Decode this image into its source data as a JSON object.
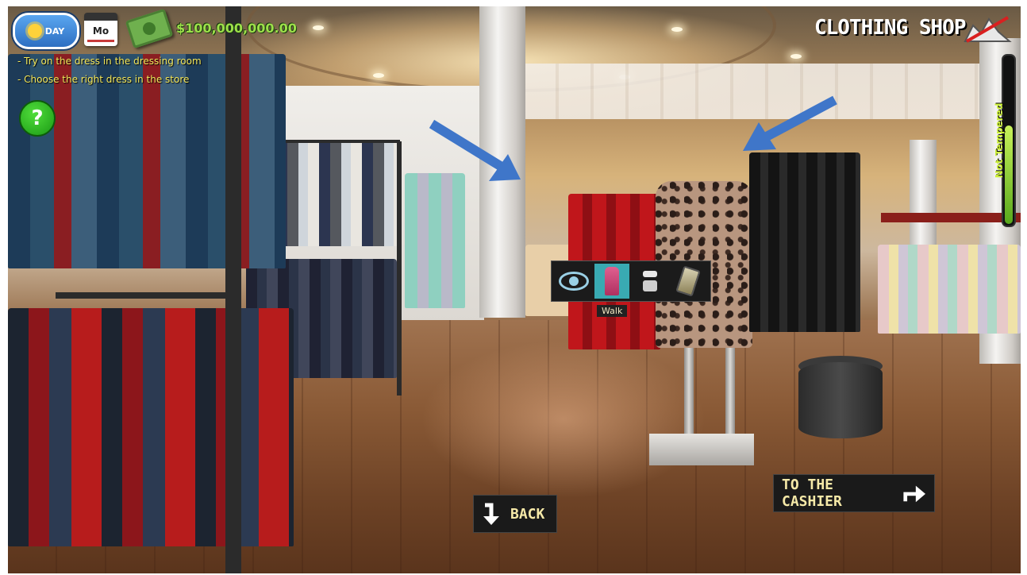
{
  "hud": {
    "day_label": "DAY",
    "calendar_day": "Mo",
    "money": "$100,000,000.00",
    "tasks": [
      "- Try on the dress in the dressing room",
      "- Choose the right dress in the store"
    ],
    "help_label": "?",
    "shop_title": "CLOTHING SHOP",
    "meter_label": "Not Tempered",
    "meter_level_fraction": 0.58
  },
  "action_bar": {
    "items": [
      {
        "icon": "eye-icon",
        "selected": false
      },
      {
        "icon": "walk-icon",
        "selected": true
      },
      {
        "icon": "hanger-icon",
        "selected": false
      },
      {
        "icon": "phone-icon",
        "selected": false
      }
    ],
    "tooltip": "Walk"
  },
  "nav": {
    "back_label": "BACK",
    "back_icon": "curved-arrow-down-icon",
    "cashier_label": "TO THE CASHIER",
    "cashier_icon": "curved-arrow-right-icon"
  },
  "colors": {
    "task_text": "#f3e75a",
    "money_text": "#9de04a",
    "selected_action": "#39aab2",
    "arrow": "#3f76c9"
  }
}
